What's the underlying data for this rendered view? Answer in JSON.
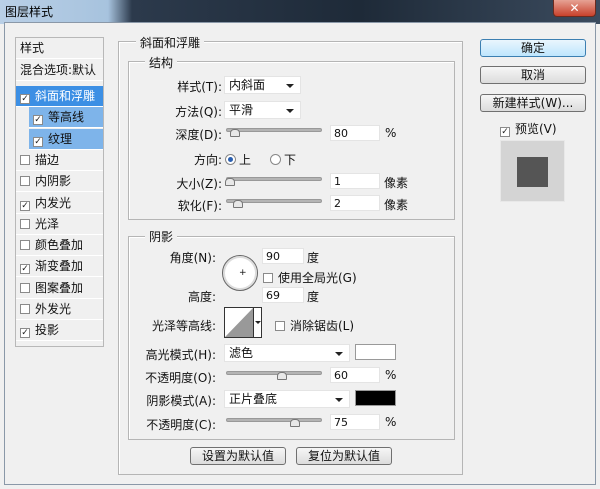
{
  "window": {
    "title": "图层样式",
    "close": "✕"
  },
  "styles_list": {
    "header": "样式",
    "blend": "混合选项:默认",
    "items": [
      {
        "label": "斜面和浮雕",
        "checked": true
      },
      {
        "label": "等高线",
        "checked": true
      },
      {
        "label": "纹理",
        "checked": true
      },
      {
        "label": "描边",
        "checked": false
      },
      {
        "label": "内阴影",
        "checked": false
      },
      {
        "label": "内发光",
        "checked": true
      },
      {
        "label": "光泽",
        "checked": false
      },
      {
        "label": "颜色叠加",
        "checked": false
      },
      {
        "label": "渐变叠加",
        "checked": true
      },
      {
        "label": "图案叠加",
        "checked": false
      },
      {
        "label": "外发光",
        "checked": false
      },
      {
        "label": "投影",
        "checked": true
      }
    ]
  },
  "bevel": {
    "title": "斜面和浮雕",
    "structure": {
      "title": "结构",
      "style_label": "样式(T):",
      "style_value": "内斜面",
      "technique_label": "方法(Q):",
      "technique_value": "平滑",
      "depth_label": "深度(D):",
      "depth": "80",
      "depth_unit": "%",
      "direction_label": "方向:",
      "up": "上",
      "down": "下",
      "direction": "上",
      "size_label": "大小(Z):",
      "size": "1",
      "size_unit": "像素",
      "soften_label": "软化(F):",
      "soften": "2",
      "soften_unit": "像素"
    },
    "shading": {
      "title": "阴影",
      "angle_label": "角度(N):",
      "angle": "90",
      "angle_unit": "度",
      "global_light": "使用全局光(G)",
      "global_light_checked": false,
      "altitude_label": "高度:",
      "altitude": "69",
      "altitude_unit": "度",
      "gloss_label": "光泽等高线:",
      "antialias": "消除锯齿(L)",
      "antialias_checked": false,
      "highlight_label": "高光模式(H):",
      "highlight_mode": "滤色",
      "highlight_color": "#ffffff",
      "hl_opacity_label": "不透明度(O):",
      "hl_opacity": "60",
      "pct": "%",
      "shadow_label": "阴影模式(A):",
      "shadow_mode": "正片叠底",
      "shadow_color": "#000000",
      "sh_opacity_label": "不透明度(C):",
      "sh_opacity": "75"
    },
    "make_default": "设置为默认值",
    "reset_default": "复位为默认值"
  },
  "side": {
    "ok": "确定",
    "cancel": "取消",
    "new_style": "新建样式(W)...",
    "preview": "预览(V)",
    "preview_checked": true
  },
  "colors": {
    "selection": "#3c8fe4",
    "sub_selection": "#7eb4ea",
    "preview_square": "#555555"
  }
}
